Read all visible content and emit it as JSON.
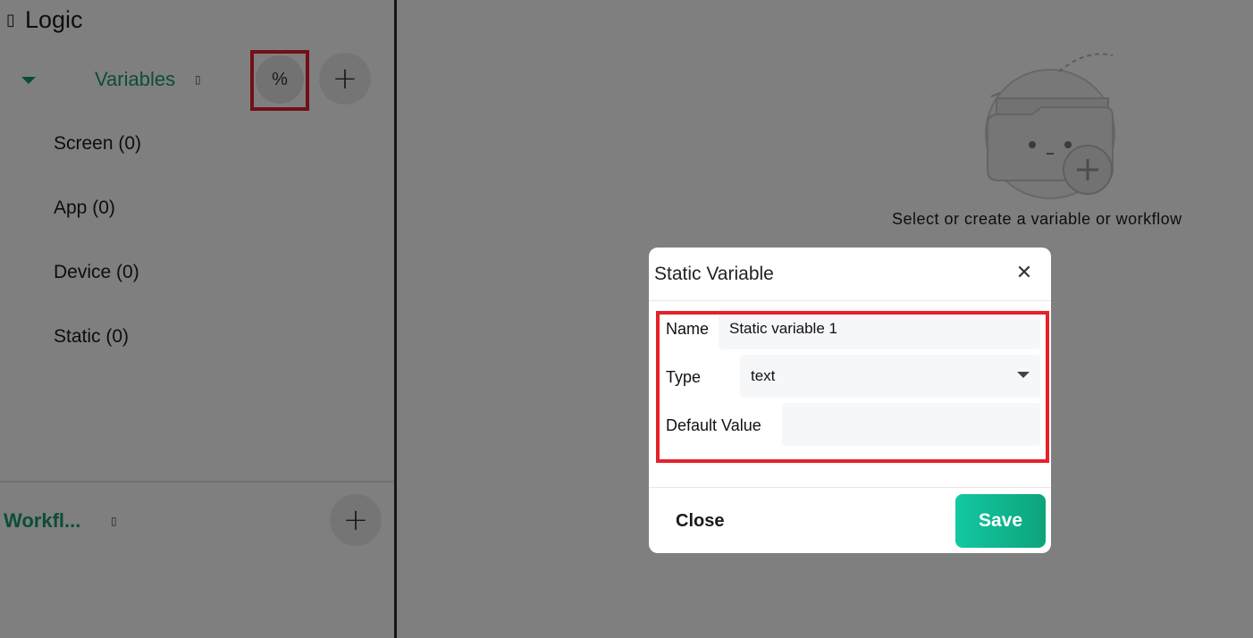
{
  "sidebar": {
    "header_icon": "▯",
    "title": "Logic",
    "variables": {
      "label": "Variables",
      "info_icon": "▯",
      "percent_label": "%",
      "add_label": "+"
    },
    "items": [
      {
        "label": "Screen (0)"
      },
      {
        "label": "App (0)"
      },
      {
        "label": "Device (0)"
      },
      {
        "label": "Static (0)"
      }
    ],
    "workflows": {
      "label": "Workfl...",
      "info_icon": "▯",
      "add_label": "+"
    }
  },
  "main": {
    "empty_text": "Select or create a variable or workflow"
  },
  "dialog": {
    "title": "Static Variable",
    "close_icon": "✕",
    "name_label": "Name",
    "name_value": "Static variable 1",
    "type_label": "Type",
    "type_value": "text",
    "default_label": "Default Value",
    "default_value": "",
    "close_label": "Close",
    "save_label": "Save"
  },
  "colors": {
    "accent": "#1a9a6c",
    "save_start": "#12c8a2",
    "save_end": "#0da37b",
    "highlight": "#e5212a"
  }
}
